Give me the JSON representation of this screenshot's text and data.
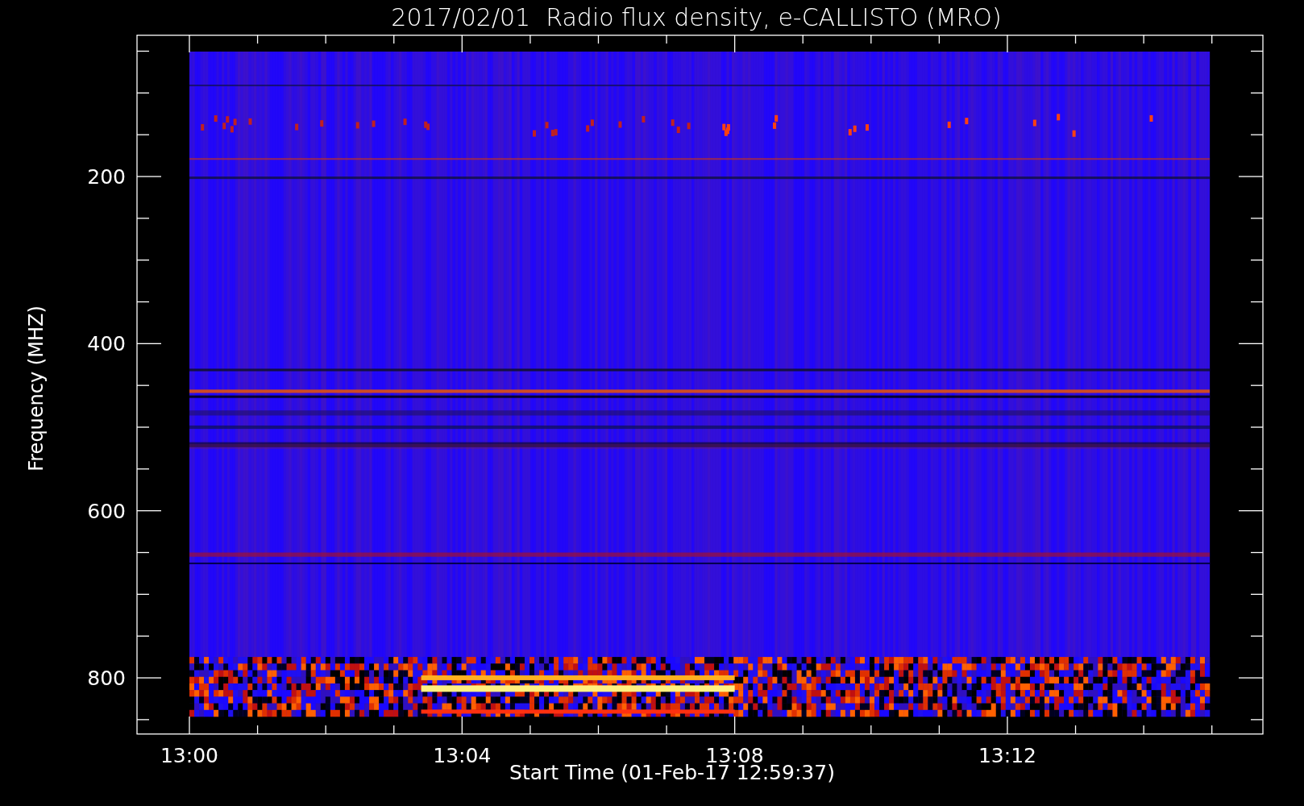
{
  "title": "2017/02/01  Radio flux density, e-CALLISTO (MRO)",
  "plot": {
    "ylabel": "Frequency (MHZ)",
    "xlabel": "Start Time (01-Feb-17 12:59:37)",
    "yticks": [
      "200",
      "400",
      "600",
      "800"
    ],
    "xticks": [
      "13:00",
      "13:04",
      "13:08",
      "13:12"
    ]
  }
}
